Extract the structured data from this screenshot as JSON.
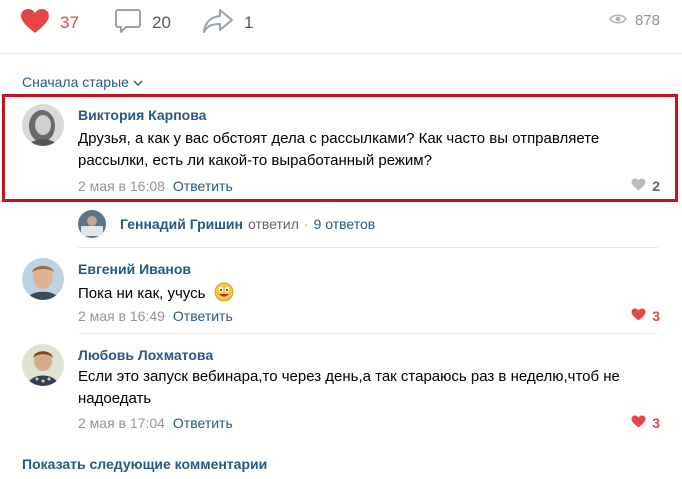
{
  "post_actions": {
    "likes": "37",
    "comments": "20",
    "shares": "1",
    "views": "878",
    "like_color": "#e64646",
    "link_color": "#2a5885"
  },
  "sort": {
    "label": "Сначала старые"
  },
  "comments": [
    {
      "author": "Виктория Карпова",
      "text": "Друзья, а как у вас обстоят дела с рассылками? Как часто вы отправляете рассылки, есть ли какой-то выработанный режим?",
      "date": "2 мая в 16:08",
      "reply": "Ответить",
      "likes": "2",
      "liked": false
    },
    {
      "author": "Евгений Иванов",
      "text": "Пока ни как, учусь",
      "date": "2 мая в 16:49",
      "reply": "Ответить",
      "likes": "3",
      "liked": true
    },
    {
      "author": "Любовь Лохматова",
      "text": "Если это запуск вебинара,то через день,а так стараюсь раз в неделю,чтоб не надоедать",
      "date": "2 мая в 17:04",
      "reply": "Ответить",
      "likes": "3",
      "liked": true
    }
  ],
  "thread": {
    "author": "Геннадий Гришин",
    "verb": "ответил",
    "separator": "·",
    "count": "9 ответов"
  },
  "show_more": {
    "label": "Показать следующие комментарии"
  },
  "icons": {
    "like": "heart-icon",
    "comment": "speech-bubble-icon",
    "share": "share-arrow-icon",
    "views": "eye-icon",
    "sort": "chevron-down-icon",
    "emoji": "grinning-emoji-icon"
  }
}
